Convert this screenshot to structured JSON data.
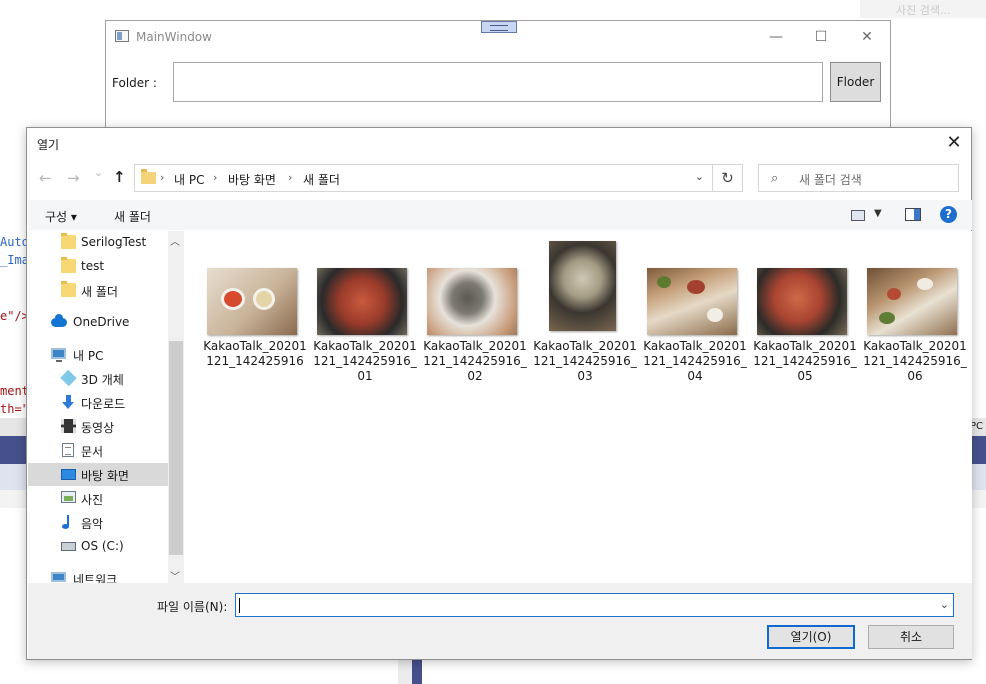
{
  "background": {
    "code_lines": [
      "Auto",
      "_Ima",
      "e\"/>",
      "ment",
      "th=\""
    ],
    "right_label": "PC",
    "top_right_text": "사진 검색..."
  },
  "main_window": {
    "title": "MainWindow",
    "minimize": "—",
    "maximize": "☐",
    "close": "✕",
    "folder_label": "Folder :",
    "folder_value": "",
    "folder_button": "Floder"
  },
  "dialog": {
    "title": "열기",
    "close": "✕",
    "back": "←",
    "forward": "→",
    "recent": "⌄",
    "up": "↑",
    "breadcrumb": [
      "내 PC",
      "바탕 화면",
      "새 폴더"
    ],
    "breadcrumb_sep": "›",
    "address_dropdown": "⌄",
    "refresh": "↻",
    "search_icon": "⌕",
    "search_placeholder": "새 폴더 검색",
    "commands": {
      "organize": "구성 ▾",
      "new_folder": "새 폴더",
      "view_caret": "▼",
      "help": "?"
    },
    "nav_items": [
      {
        "label": "SerilogTest",
        "icon": "folder-icon"
      },
      {
        "label": "test",
        "icon": "folder-icon"
      },
      {
        "label": "새 폴더",
        "icon": "folder-icon"
      },
      {
        "label": "OneDrive",
        "icon": "onedrive-icon"
      },
      {
        "label": "내 PC",
        "icon": "pc-icon"
      },
      {
        "label": "3D 개체",
        "icon": "3d-objects-icon"
      },
      {
        "label": "다운로드",
        "icon": "download-icon"
      },
      {
        "label": "동영상",
        "icon": "video-icon"
      },
      {
        "label": "문서",
        "icon": "document-icon"
      },
      {
        "label": "바탕 화면",
        "icon": "desktop-icon"
      },
      {
        "label": "사진",
        "icon": "pictures-icon"
      },
      {
        "label": "음악",
        "icon": "music-icon"
      },
      {
        "label": "OS (C:)",
        "icon": "drive-icon"
      },
      {
        "label": "네트워크",
        "icon": "network-icon"
      }
    ],
    "selected_nav": "바탕 화면",
    "scroll_up": "︿",
    "scroll_down": "﹀",
    "files": [
      {
        "name": "KakaoTalk_20201121_142425916"
      },
      {
        "name": "KakaoTalk_20201121_142425916_01"
      },
      {
        "name": "KakaoTalk_20201121_142425916_02"
      },
      {
        "name": "KakaoTalk_20201121_142425916_03"
      },
      {
        "name": "KakaoTalk_20201121_142425916_04"
      },
      {
        "name": "KakaoTalk_20201121_142425916_05"
      },
      {
        "name": "KakaoTalk_20201121_142425916_06"
      }
    ],
    "filename_label": "파일 이름(N):",
    "filename_value": "",
    "filename_dropdown": "⌄",
    "open_button": "열기(O)",
    "cancel_button": "취소"
  },
  "colors": {
    "accent": "#0f6bd0",
    "selection": "#d9d9d9",
    "folder": "#f7d774"
  }
}
